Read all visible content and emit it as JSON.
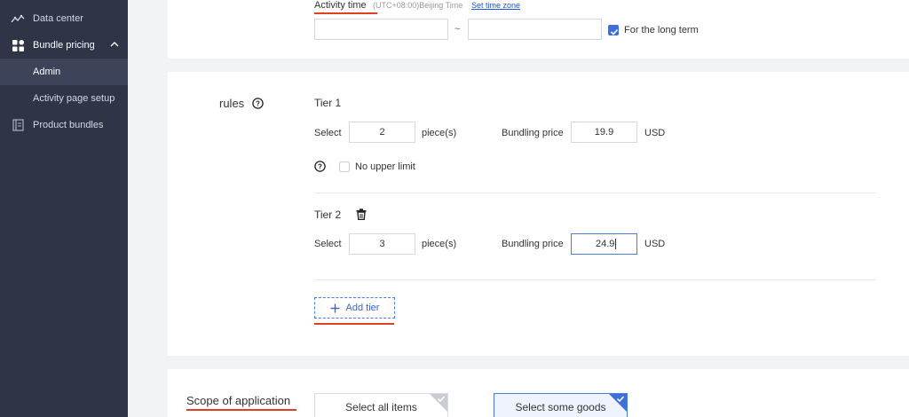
{
  "sidebar": {
    "items": [
      {
        "label": "Data center",
        "icon": "chart-line-icon"
      },
      {
        "label": "Bundle pricing",
        "icon": "grid-icon"
      },
      {
        "label": "Admin"
      },
      {
        "label": "Activity page setup"
      },
      {
        "label": "Product bundles",
        "icon": "document-icon"
      }
    ]
  },
  "activity_time": {
    "label": "Activity time",
    "timezone": "(UTC+08:00)Beijing Time",
    "set_timezone_link": "Set time zone",
    "start_value": "",
    "end_value": "",
    "separator": "~",
    "long_term_label": "For the long term",
    "long_term_checked": true
  },
  "rules": {
    "label": "rules",
    "tier1": {
      "title": "Tier 1",
      "select_label": "Select",
      "quantity": "2",
      "unit": "piece(s)",
      "price_label": "Bundling price",
      "price": "19.9",
      "currency": "USD",
      "no_upper_limit_label": "No upper limit"
    },
    "tier2": {
      "title": "Tier 2",
      "select_label": "Select",
      "quantity": "3",
      "unit": "piece(s)",
      "price_label": "Bundling price",
      "price": "24.9",
      "currency": "USD"
    },
    "add_tier_label": "Add tier"
  },
  "scope": {
    "label": "Scope of application",
    "options": [
      {
        "label": "Select all items",
        "selected": false
      },
      {
        "label": "Select some goods",
        "selected": true
      }
    ]
  },
  "colors": {
    "sidebar_bg": "#2f3447",
    "accent": "#3f6fd8",
    "underline_red": "#e0401e"
  }
}
